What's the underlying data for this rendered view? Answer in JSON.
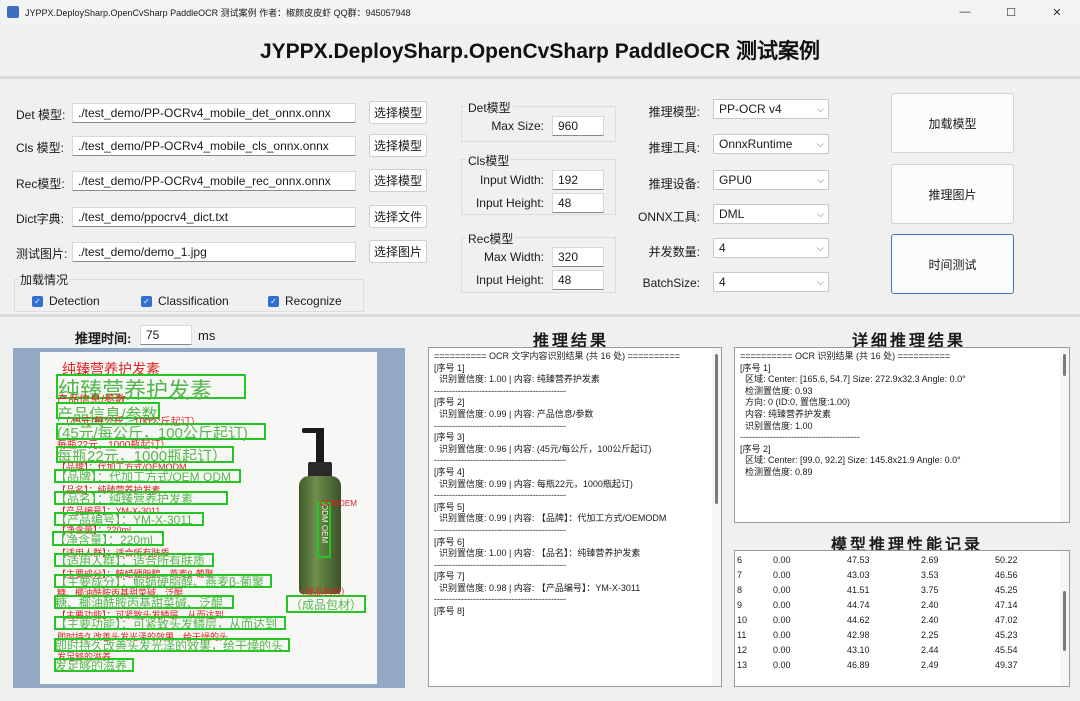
{
  "window": {
    "title": "JYPPX.DeploySharp.OpenCvSharp  PaddleOCR 测试案例  作者：椒颜皮皮虾   QQ群：945057948",
    "minimize": "—",
    "maximize": "☐",
    "close": "✕"
  },
  "banner": "JYPPX.DeploySharp.OpenCvSharp  PaddleOCR 测试案例",
  "files": [
    {
      "label": "Det 模型:",
      "value": "./test_demo/PP-OCRv4_mobile_det_onnx.onnx",
      "button": "选择模型"
    },
    {
      "label": "Cls 模型:",
      "value": "./test_demo/PP-OCRv4_mobile_cls_onnx.onnx",
      "button": "选择模型"
    },
    {
      "label": "Rec模型:",
      "value": "./test_demo/PP-OCRv4_mobile_rec_onnx.onnx",
      "button": "选择模型"
    },
    {
      "label": "Dict字典:",
      "value": "./test_demo/ppocrv4_dict.txt",
      "button": "选择文件"
    },
    {
      "label": "测试图片:",
      "value": "./test_demo/demo_1.jpg",
      "button": "选择图片"
    }
  ],
  "load_status": {
    "title": "加载情况",
    "items": [
      "Detection",
      "Classification",
      "Recognize"
    ]
  },
  "det": {
    "title": "Det模型",
    "max_size_label": "Max Size:",
    "max_size": "960"
  },
  "cls": {
    "title": "Cls模型",
    "w_label": "Input Width:",
    "w": "192",
    "h_label": "Input Height:",
    "h": "48"
  },
  "rec": {
    "title": "Rec模型",
    "w_label": "Max Width:",
    "w": "320",
    "h_label": "Input Height:",
    "h": "48"
  },
  "options": [
    {
      "label": "推理模型:",
      "value": "PP-OCR v4"
    },
    {
      "label": "推理工具:",
      "value": "OnnxRuntime"
    },
    {
      "label": "推理设备:",
      "value": "GPU0"
    },
    {
      "label": "ONNX工具:",
      "value": "DML"
    },
    {
      "label": "并发数量:",
      "value": "4"
    },
    {
      "label": "BatchSize:",
      "value": "4"
    }
  ],
  "buttons": {
    "load": "加载模型",
    "infer": "推理图片",
    "timing": "时间测试"
  },
  "infer_time": {
    "label": "推理时间:",
    "value": "75",
    "unit": "ms"
  },
  "sections": {
    "result": "推理结果",
    "detail": "详细推理结果",
    "perf": "模型推理性能记录"
  },
  "result_lines": [
    "========== OCR 文字内容识别结果 (共 16 处) ==========",
    "[序号 1]",
    "识别置信度: 1.00  |  内容: 纯臻营养护发素",
    "--------------------------------------------",
    "[序号 2]",
    "识别置信度: 0.99  |  内容: 产品信息/参数",
    "--------------------------------------------",
    "[序号 3]",
    "识别置信度: 0.96  |  内容: (45元/每公斤，100公斤起订)",
    "--------------------------------------------",
    "[序号 4]",
    "识别置信度: 0.99  |  内容: 每瓶22元，1000瓶起订)",
    "--------------------------------------------",
    "[序号 5]",
    "识别置信度: 0.99  |  内容: 【品牌】：代加工方式/OEMODM",
    "--------------------------------------------",
    "[序号 6]",
    "识别置信度: 1.00  |  内容: 【品名】：纯臻营养护发素",
    "--------------------------------------------",
    "[序号 7]",
    "识别置信度: 0.98  |  内容: 【产品编号】：YM-X-3011",
    "--------------------------------------------",
    "[序号 8]"
  ],
  "detail_lines": [
    "========== OCR 识别结果 (共 16 处) ==========",
    "[序号 1]",
    "区域: Center: [165.6, 54.7] Size: 272.9x32.3 Angle: 0.0°",
    "检测置信度: 0.93",
    "方向: 0 (ID:0, 置信度:1.00)",
    "内容: 纯臻营养护发素",
    "识别置信度: 1.00",
    "----------------------------------------",
    "[序号 2]",
    "区域: Center: [99.0, 92.2] Size: 145.8x21.9 Angle: 0.0°",
    "检测置信度: 0.89"
  ],
  "perf_rows": [
    [
      "6",
      "0.00",
      "47.53",
      "2.69",
      "50.22"
    ],
    [
      "7",
      "0.00",
      "43.03",
      "3.53",
      "46.56"
    ],
    [
      "8",
      "0.00",
      "41.51",
      "3.75",
      "45.25"
    ],
    [
      "9",
      "0.00",
      "44.74",
      "2.40",
      "47.14"
    ],
    [
      "10",
      "0.00",
      "44.62",
      "2.40",
      "47.02"
    ],
    [
      "11",
      "0.00",
      "42.98",
      "2.25",
      "45.23"
    ],
    [
      "12",
      "0.00",
      "43.10",
      "2.44",
      "45.54"
    ],
    [
      "13",
      "0.00",
      "46.89",
      "2.49",
      "49.37"
    ]
  ],
  "photo_text": {
    "t1_red": "纯臻营养护发素",
    "t1": "纯臻营养护发素",
    "t2_red": "产品信息/参数",
    "t2": "产品信息/参数",
    "t3_red": "（45元/每公斤，100公斤起订）",
    "t3": "(45元/每公斤，100公斤起订)",
    "t4_red": "每瓶22元，1000瓶起订）",
    "t4": "每瓶22元，1000瓶起订）",
    "t5_red": "【品牌】：代加工方式/OEMODM",
    "t5": "【品牌】：代加工方式/OEM ODM",
    "t6_red": "【品名】：纯臻营养护发素",
    "t6": "【品名】：纯臻营养护发素",
    "t7_red": "【产品编号】：YM-X-3011",
    "t7": "【产品编号】：YM-X-3011",
    "t8_red": "【净含量】：220ml",
    "t8": "【净含量】：220ml",
    "t9_red": "【适用人群】：适合所有肤质",
    "t9": "【适用人群】：适合所有肤质",
    "t10_red": "【主要成分】：鲸蜡硬脂醇、燕麦β-葡聚",
    "t10": "【主要成分】：鲸蜡硬脂醇、燕麦β-葡聚",
    "t11_red": "糖、椰油酰胺丙基甜菜碱、泛醌",
    "t11": "糖、椰油酰胺丙基甜菜碱、泛醌",
    "t12_red": "【主要功能】：可紧致头发鳞层，从而达到",
    "t12": "【主要功能】：可紧致头发鳞层，从而达到",
    "t13_red": "即时持久改善头发光泽的效果，给干燥的头",
    "t13": "即时持久改善头发光泽的效果，给干燥的头",
    "t14_red": "发足够的滋养",
    "t14": "发足够的滋养",
    "bottle_red": "ODMOEM",
    "bottle": "ODM OEM",
    "tag_red": "（成品包材）",
    "tag": "（成品包材）"
  }
}
